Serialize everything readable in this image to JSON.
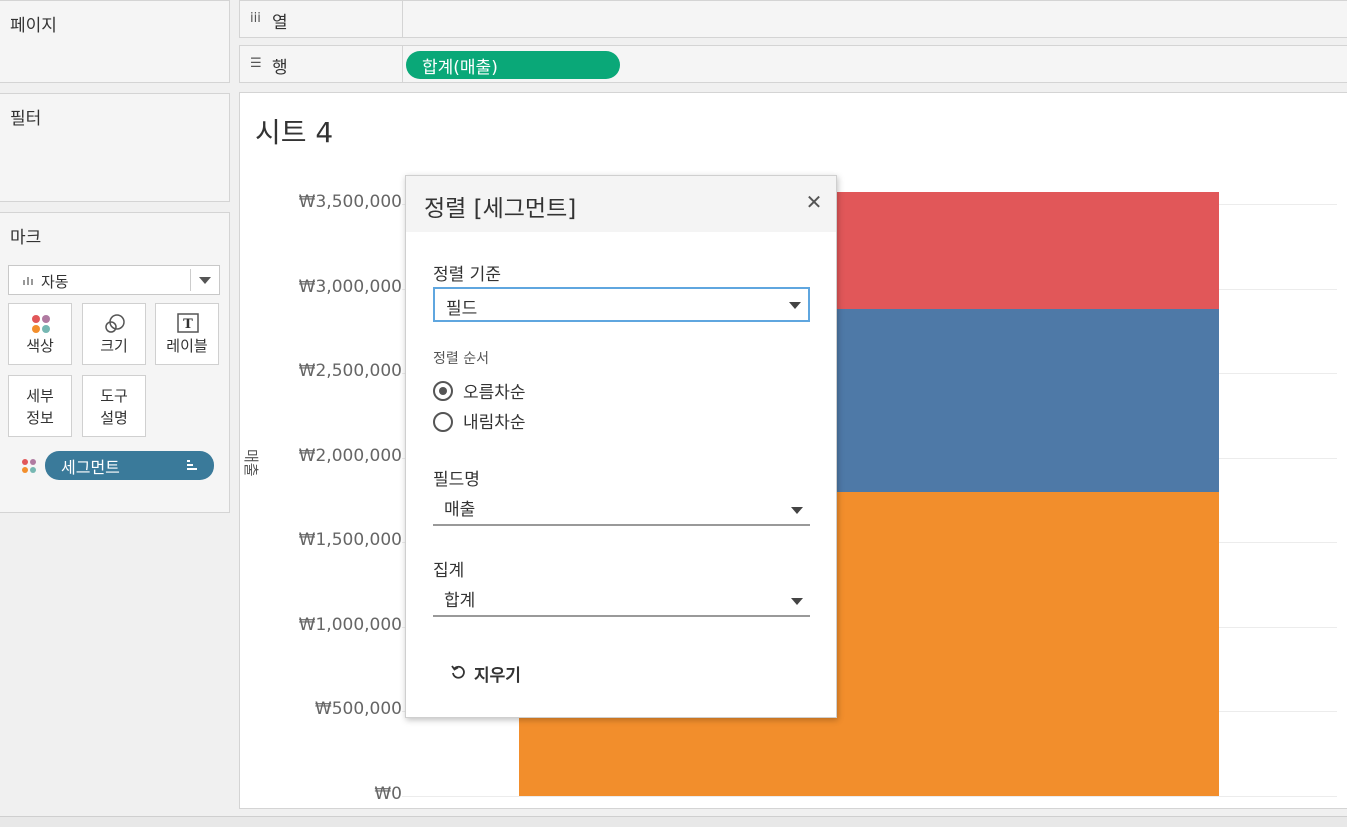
{
  "left": {
    "pages_title": "페이지",
    "filters_title": "필터",
    "marks": {
      "title": "마크",
      "type": "자동",
      "buttons": [
        "색상",
        "크기",
        "레이블"
      ],
      "detail_label": "세부\n정보",
      "tooltip_label": "도구\n설명",
      "pill": "세그먼트"
    }
  },
  "shelves": {
    "columns_label": "열",
    "rows_label": "행",
    "rows_pill": "합계(매출)"
  },
  "sheet": {
    "title": "시트 4",
    "y_label": "매출"
  },
  "chart_data": {
    "type": "bar",
    "stacked": true,
    "ylabel": "매출",
    "ylim": [
      0,
      3500000
    ],
    "yticks": [
      "₩0",
      "₩500,000",
      "₩1,000,000",
      "₩1,500,000",
      "₩2,000,000",
      "₩2,500,000",
      "₩3,000,000",
      "₩3,500,000"
    ],
    "ytick_values": [
      0,
      500000,
      1000000,
      1500000,
      2000000,
      2500000,
      3000000,
      3500000
    ],
    "segments": [
      {
        "value": 1800000,
        "color": "#f28e2c"
      },
      {
        "value": 1080000,
        "color": "#4e79a7"
      },
      {
        "value": 690000,
        "color": "#e15759"
      }
    ]
  },
  "dialog": {
    "title": "정렬 [세그먼트]",
    "sort_by_label": "정렬 기준",
    "sort_by_value": "필드",
    "order_label": "정렬 순서",
    "ascending": "오름차순",
    "descending": "내림차순",
    "field_label": "필드명",
    "field_value": "매출",
    "agg_label": "집계",
    "agg_value": "합계",
    "clear_label": "지우기"
  },
  "colors": {
    "accent_green": "#0aa878",
    "segment_pill": "#3a7a9a"
  }
}
